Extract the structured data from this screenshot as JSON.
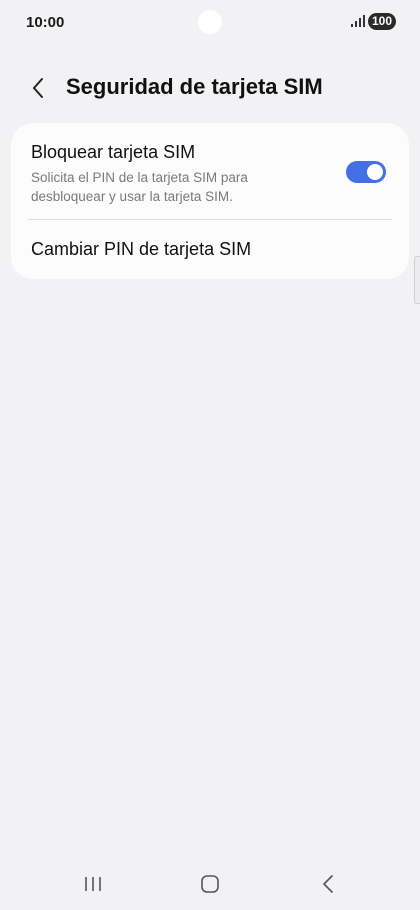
{
  "status_bar": {
    "time": "10:00",
    "battery": "100",
    "icons": [
      "front-camera-icon",
      "signal-icon",
      "battery-icon"
    ]
  },
  "header": {
    "title": "Seguridad de tarjeta SIM",
    "back_icon": "chevron-left-icon"
  },
  "settings": {
    "lock_sim": {
      "title": "Bloquear tarjeta SIM",
      "description": "Solicita el PIN de la tarjeta SIM para desbloquear y usar la tarjeta SIM.",
      "enabled": true
    },
    "change_pin": {
      "label": "Cambiar PIN de tarjeta SIM"
    }
  },
  "nav_bar": {
    "icons": [
      "recent-apps-icon",
      "home-icon",
      "back-icon"
    ]
  },
  "colors": {
    "accent": "#4470e6",
    "background": "#f2f2f4",
    "card": "#fcfcfd"
  }
}
